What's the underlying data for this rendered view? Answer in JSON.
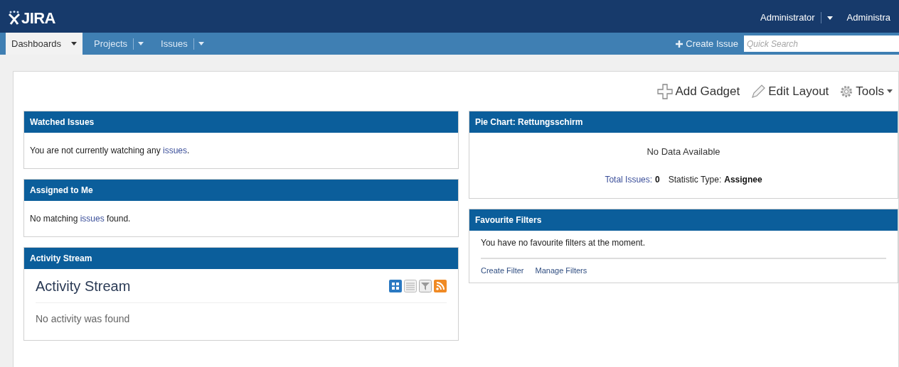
{
  "header": {
    "logo": "JIRA",
    "user_menus": [
      {
        "label": "Administrator",
        "dropdown": true
      },
      {
        "label": "Administra",
        "dropdown": false
      }
    ]
  },
  "nav": {
    "tabs": [
      {
        "label": "Dashboards",
        "selected": true
      },
      {
        "label": "Projects",
        "selected": false
      },
      {
        "label": "Issues",
        "selected": false
      }
    ],
    "create_button": "Create Issue",
    "search": {
      "placeholder": "Quick Search"
    }
  },
  "toolbar": [
    {
      "kind": "add",
      "label": "Add Gadget"
    },
    {
      "kind": "edit",
      "label": "Edit Layout"
    },
    {
      "kind": "tools",
      "label": "Tools"
    }
  ],
  "left_gadgets": [
    {
      "kind": "message",
      "title": "Watched Issues",
      "before": "You are not currently watching any ",
      "link": "issues",
      "after": "."
    },
    {
      "kind": "message",
      "title": "Assigned to Me",
      "before": "No matching ",
      "link": "issues",
      "after": " found."
    },
    {
      "kind": "stream",
      "title": "Activity Stream",
      "heading": "Activity Stream",
      "empty": "No activity was found"
    }
  ],
  "right_gadgets": [
    {
      "kind": "pie",
      "title": "Pie Chart: Rettungsschirm",
      "empty": "No Data Available",
      "stats": [
        {
          "label": "Total Issues:",
          "value": "0",
          "kind": "link"
        },
        {
          "label": "Statistic Type:",
          "value": "Assignee",
          "kind": "plain"
        }
      ]
    },
    {
      "kind": "filters",
      "title": "Favourite Filters",
      "message": "You have no favourite filters at the moment.",
      "links": [
        "Create Filter",
        "Manage Filters"
      ]
    }
  ]
}
